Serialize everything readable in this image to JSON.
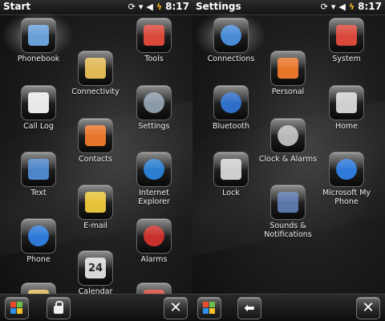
{
  "status": {
    "time": "8:17"
  },
  "start": {
    "title": "Start",
    "tiles": [
      {
        "id": "phonebook",
        "label": "Phonebook",
        "color": "#6aa0d8"
      },
      {
        "id": "call-log",
        "label": "Call Log",
        "color": "#e8e8e8"
      },
      {
        "id": "text",
        "label": "Text",
        "color": "#4d86c9"
      },
      {
        "id": "phone",
        "label": "Phone",
        "color": "#2f7ad9"
      },
      {
        "id": "connectivity",
        "label": "Connectivity",
        "color": "#e0b856"
      },
      {
        "id": "contacts",
        "label": "Contacts",
        "color": "#e8762a"
      },
      {
        "id": "email",
        "label": "E-mail",
        "color": "#e6c23a"
      },
      {
        "id": "calendar",
        "label": "Calendar",
        "color": "#d8d8d8",
        "badge": "24"
      },
      {
        "id": "tools",
        "label": "Tools",
        "color": "#d9483b"
      },
      {
        "id": "settings",
        "label": "Settings",
        "color": "#8c9aa8"
      },
      {
        "id": "internet-explorer",
        "label": "Internet Explorer",
        "color": "#2c7fd0"
      },
      {
        "id": "alarms",
        "label": "Alarms",
        "color": "#c8312b"
      }
    ]
  },
  "settings": {
    "title": "Settings",
    "tiles": [
      {
        "id": "connections",
        "label": "Connections",
        "color": "#4a8bd6"
      },
      {
        "id": "bluetooth",
        "label": "Bluetooth",
        "color": "#2f6fc8"
      },
      {
        "id": "lock",
        "label": "Lock",
        "color": "#cfcfcf"
      },
      {
        "id": "personal",
        "label": "Personal",
        "color": "#e8762a"
      },
      {
        "id": "clock-alarms",
        "label": "Clock & Alarms",
        "color": "#b8b8b8"
      },
      {
        "id": "sounds-notifications",
        "label": "Sounds &\nNotifications",
        "color": "#5a76a8"
      },
      {
        "id": "system",
        "label": "System",
        "color": "#d9483b"
      },
      {
        "id": "home",
        "label": "Home",
        "color": "#cfcfcf"
      },
      {
        "id": "microsoft-my-phone",
        "label": "Microsoft My\nPhone",
        "color": "#2f7ad9"
      }
    ]
  },
  "taskbar": {
    "close_symbol": "✕",
    "back_symbol": "⬅"
  }
}
